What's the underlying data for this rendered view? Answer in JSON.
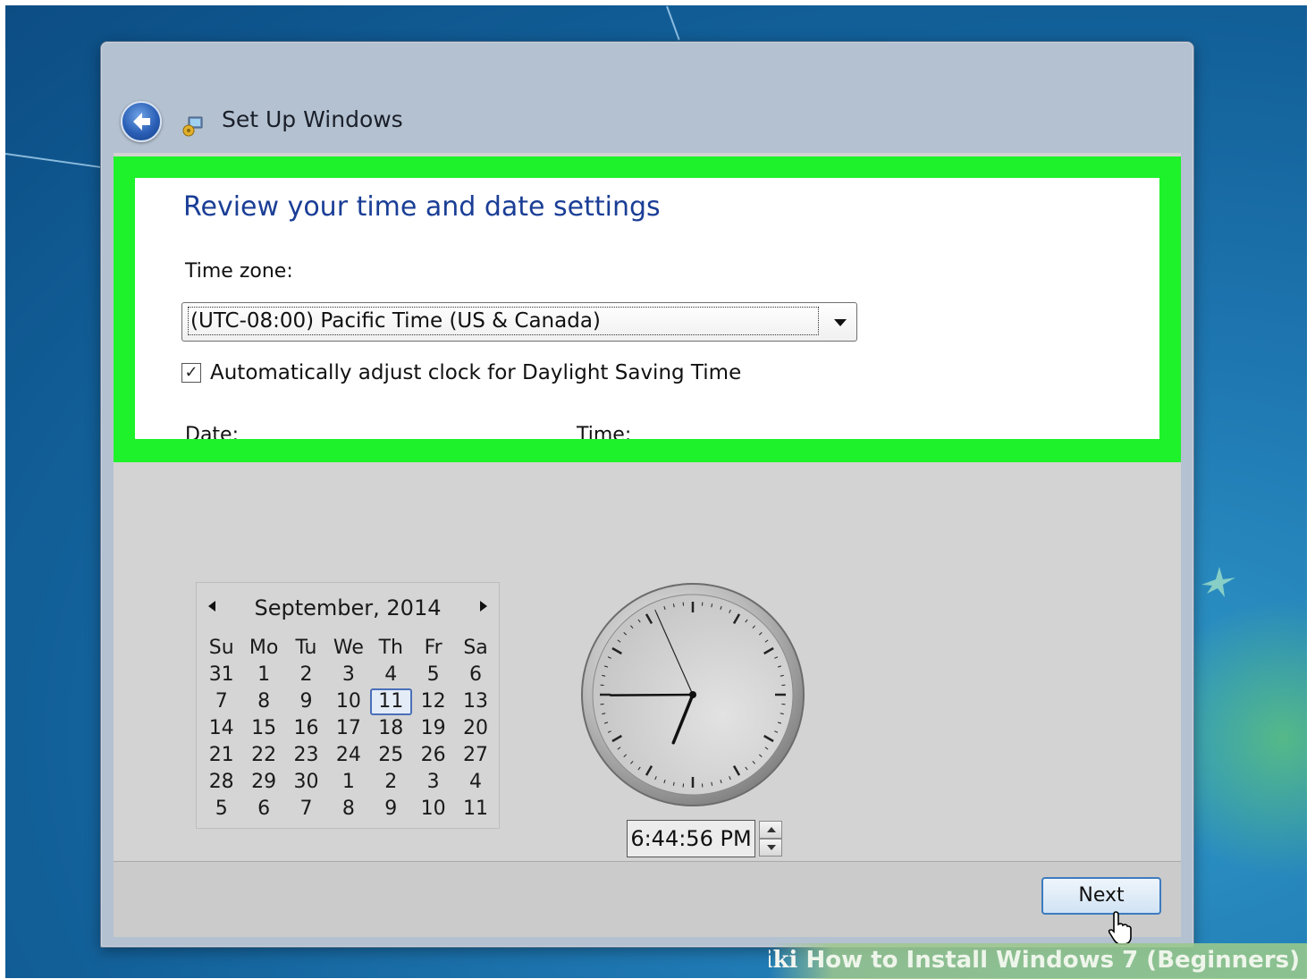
{
  "window": {
    "title": "Set Up Windows"
  },
  "page": {
    "heading": "Review your time and date settings",
    "time_zone_label": "Time zone:",
    "time_zone_value": "(UTC-08:00) Pacific Time (US & Canada)",
    "dst_checked": true,
    "dst_label": "Automatically adjust clock for Daylight Saving Time",
    "date_label": "Date:",
    "time_label": "Time:"
  },
  "calendar": {
    "month": "September, 2014",
    "weekdays": [
      "Su",
      "Mo",
      "Tu",
      "We",
      "Th",
      "Fr",
      "Sa"
    ],
    "weeks": [
      [
        "31",
        "1",
        "2",
        "3",
        "4",
        "5",
        "6"
      ],
      [
        "7",
        "8",
        "9",
        "10",
        "11",
        "12",
        "13"
      ],
      [
        "14",
        "15",
        "16",
        "17",
        "18",
        "19",
        "20"
      ],
      [
        "21",
        "22",
        "23",
        "24",
        "25",
        "26",
        "27"
      ],
      [
        "28",
        "29",
        "30",
        "1",
        "2",
        "3",
        "4"
      ],
      [
        "5",
        "6",
        "7",
        "8",
        "9",
        "10",
        "11"
      ]
    ],
    "selected_day": "11"
  },
  "clock": {
    "hour": 6,
    "minute": 44,
    "second": 56,
    "time_text": "6:44:56 PM"
  },
  "footer": {
    "next_label": "Next"
  },
  "watermark": {
    "brand": "wiki",
    "text": "How to Install Windows 7 (Beginners)"
  },
  "colors": {
    "highlight": "#1ef22a",
    "heading": "#1a3e96"
  }
}
